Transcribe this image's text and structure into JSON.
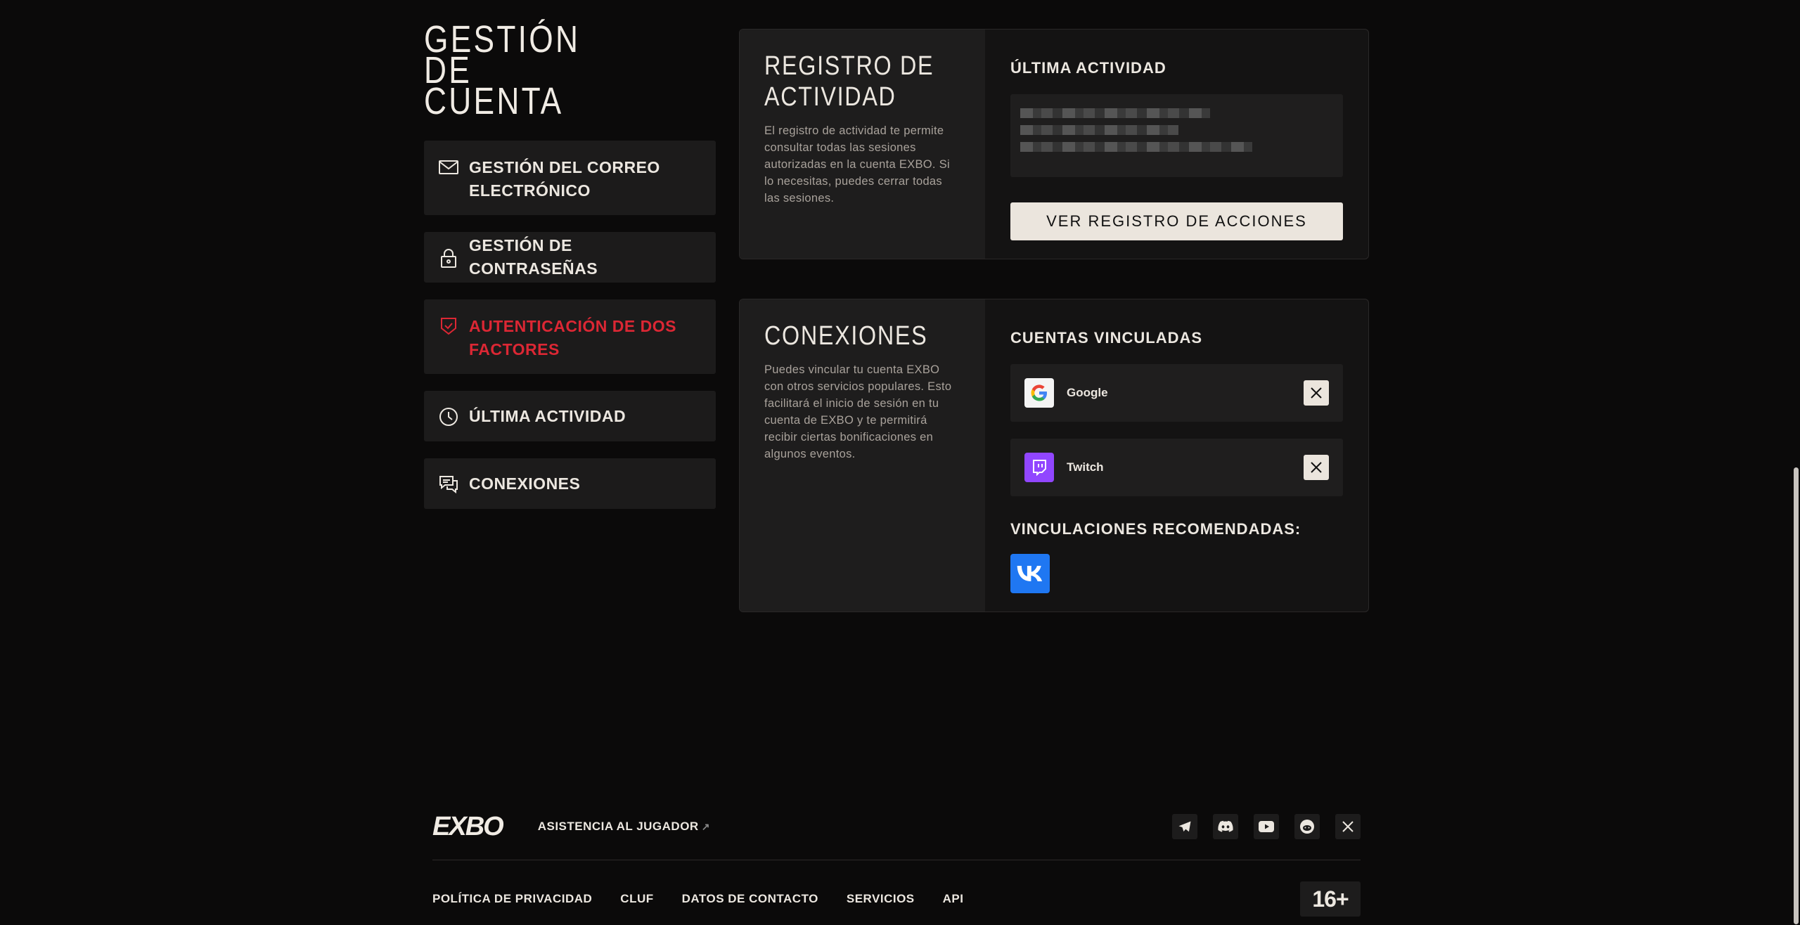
{
  "page_title": "GESTIÓN DE CUENTA",
  "nav": [
    {
      "label": "GESTIÓN DEL CORREO ELECTRÓNICO",
      "icon": "mail-icon"
    },
    {
      "label": "GESTIÓN DE CONTRASEÑAS",
      "icon": "lock-icon"
    },
    {
      "label": "AUTENTICACIÓN DE DOS FACTORES",
      "icon": "shield-check-icon",
      "active": true
    },
    {
      "label": "ÚLTIMA ACTIVIDAD",
      "icon": "clock-icon"
    },
    {
      "label": "CONEXIONES",
      "icon": "chat-icon"
    }
  ],
  "activity_card": {
    "title": "REGISTRO DE ACTIVIDAD",
    "description": "El registro de actividad te permite consultar todas las sesiones autorizadas en la cuenta EXBO. Si lo necesitas, puedes cerrar todas las sesiones.",
    "section_title": "ÚLTIMA ACTIVIDAD",
    "button_label": "VER REGISTRO DE ACCIONES"
  },
  "connections_card": {
    "title": "CONEXIONES",
    "description": "Puedes vincular tu cuenta EXBO con otros servicios populares. Esto facilitará el inicio de sesión en tu cuenta de EXBO y te permitirá recibir ciertas bonificaciones en algunos eventos.",
    "linked_title": "CUENTAS VINCULADAS",
    "linked": [
      {
        "name": "Google",
        "icon": "google-icon"
      },
      {
        "name": "Twitch",
        "icon": "twitch-icon"
      }
    ],
    "recommended_title": "VINCULACIONES RECOMENDADAS:",
    "recommended": [
      {
        "icon": "vk-icon"
      }
    ]
  },
  "footer": {
    "logo": "EXBO",
    "assist_label": "ASISTENCIA AL JUGADOR",
    "assist_arrow": "↗",
    "socials": [
      "telegram-icon",
      "discord-icon",
      "youtube-icon",
      "reddit-icon",
      "x-icon"
    ],
    "links": [
      "POLÍTICA DE PRIVACIDAD",
      "CLUF",
      "DATOS DE CONTACTO",
      "SERVICIOS",
      "API"
    ],
    "age_rating": "16+"
  },
  "colors": {
    "accent": "#dc2734",
    "background": "#0b0a0a",
    "panel": "#1c1b1b"
  }
}
